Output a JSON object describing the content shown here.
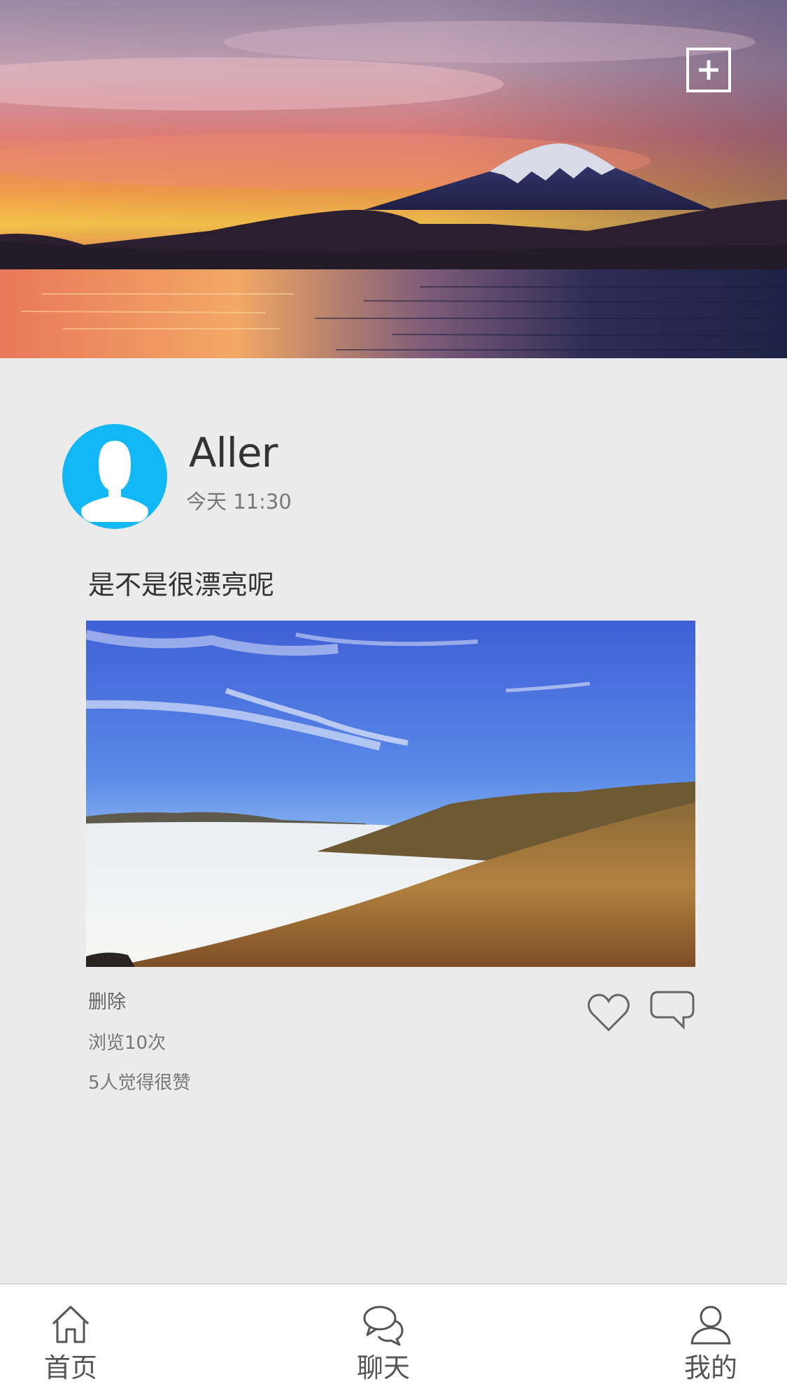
{
  "header": {
    "cover_image": "mountain-lake-sunset",
    "add_icon": "plus-square-icon"
  },
  "post": {
    "avatar_icon": "default-user-avatar-icon",
    "username": "Aller",
    "time": "今天 11:30",
    "text": "是不是很漂亮呢",
    "image": "mountain-sea-of-clouds",
    "delete_label": "删除",
    "views": "浏览10次",
    "likes": "5人觉得很赞",
    "like_icon": "heart-outline-icon",
    "comment_icon": "speech-bubble-icon"
  },
  "tabbar": {
    "tabs": [
      {
        "label": "首页",
        "icon": "home-icon"
      },
      {
        "label": "聊天",
        "icon": "chat-bubbles-icon"
      },
      {
        "label": "我的",
        "icon": "user-icon"
      }
    ]
  },
  "colors": {
    "background": "#ebebeb",
    "avatar": "#12b7f5",
    "text_primary": "#333333",
    "text_secondary": "#777777",
    "tabbar_bg": "#ffffff"
  }
}
